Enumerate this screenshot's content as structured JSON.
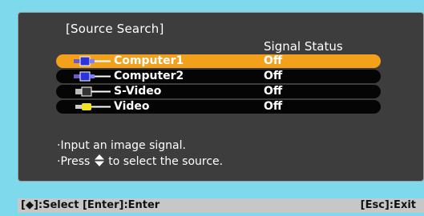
{
  "menu": {
    "title": "[Source Search]",
    "status_header": "Signal Status",
    "sources": [
      {
        "name": "Computer1",
        "status": "Off",
        "selected": true,
        "icon": "computer-connector-icon"
      },
      {
        "name": "Computer2",
        "status": "Off",
        "selected": false,
        "icon": "computer-connector-icon"
      },
      {
        "name": "S-Video",
        "status": "Off",
        "selected": false,
        "icon": "s-video-connector-icon"
      },
      {
        "name": "Video",
        "status": "Off",
        "selected": false,
        "icon": "video-connector-icon"
      }
    ],
    "help": {
      "line1": "·Input an image signal.",
      "line2_prefix": "·Press",
      "line2_suffix": "to select the source."
    }
  },
  "footer": {
    "left": "[◆]:Select  [Enter]:Enter",
    "right": "[Esc]:Exit"
  },
  "colors": {
    "screen_bg": "#7fd9ec",
    "panel_bg": "#3d3d3d",
    "selected_row": "#f3a01a",
    "row_bg": "#050505",
    "footer_bg": "#c7c7c7"
  }
}
